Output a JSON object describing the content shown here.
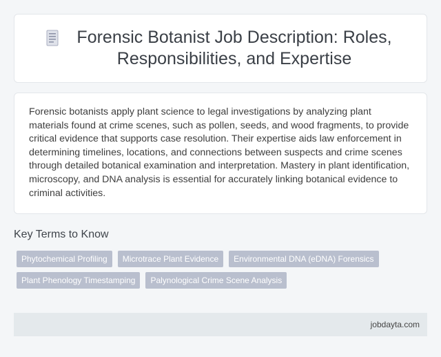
{
  "header": {
    "title": "Forensic Botanist Job Description: Roles, Responsibilities, and Expertise",
    "icon": "document-icon"
  },
  "description": "Forensic botanists apply plant science to legal investigations by analyzing plant materials found at crime scenes, such as pollen, seeds, and wood fragments, to provide critical evidence that supports case resolution. Their expertise aids law enforcement in determining timelines, locations, and connections between suspects and crime scenes through detailed botanical examination and interpretation. Mastery in plant identification, microscopy, and DNA analysis is essential for accurately linking botanical evidence to criminal activities.",
  "key_terms": {
    "heading": "Key Terms to Know",
    "tags": [
      "Phytochemical Profiling",
      "Microtrace Plant Evidence",
      "Environmental DNA (eDNA) Forensics",
      "Plant Phenology Timestamping",
      "Palynological Crime Scene Analysis"
    ]
  },
  "footer": {
    "site": "jobdayta.com"
  },
  "colors": {
    "background": "#f4f6f8",
    "tag_bg": "#b9bfce",
    "footer_bg": "#e4e9ec"
  }
}
